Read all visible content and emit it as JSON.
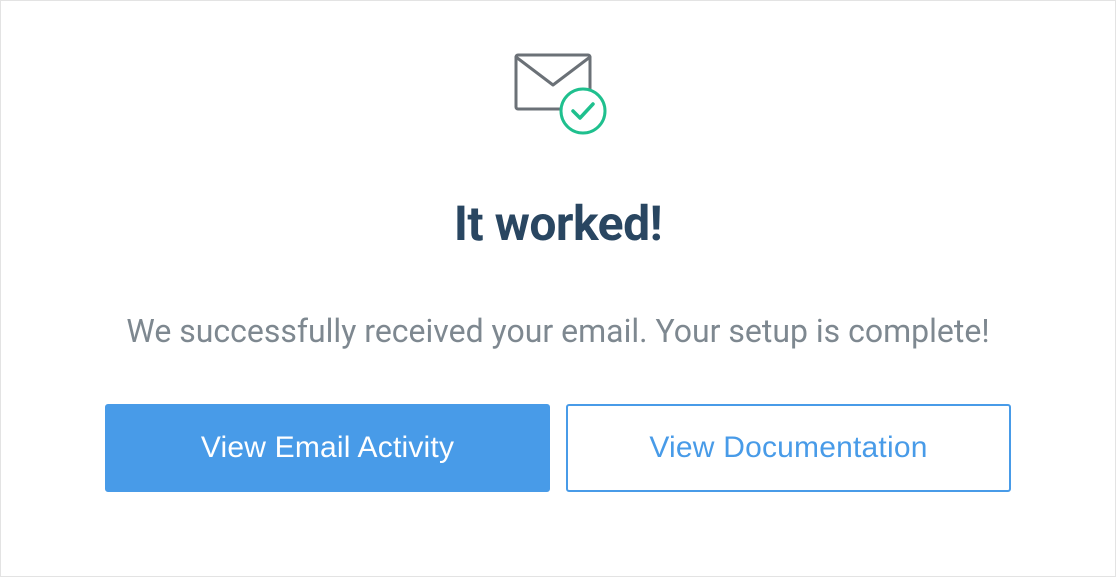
{
  "success": {
    "heading": "It worked!",
    "message": "We successfully received your email. Your setup is complete!",
    "primary_button_label": "View Email Activity",
    "secondary_button_label": "View Documentation"
  }
}
